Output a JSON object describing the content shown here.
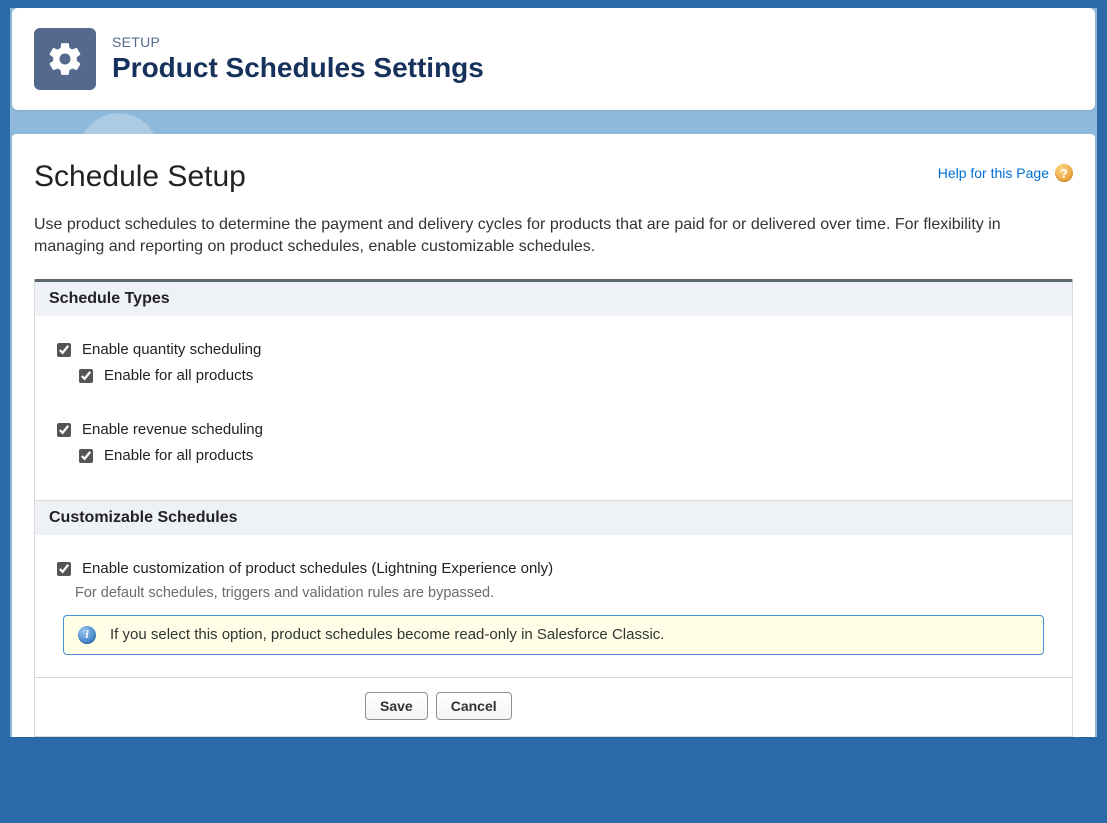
{
  "header": {
    "eyebrow": "SETUP",
    "title": "Product Schedules Settings"
  },
  "page": {
    "title": "Schedule Setup",
    "help_link_label": "Help for this Page",
    "help_icon_glyph": "?",
    "intro": "Use product schedules to determine the payment and delivery cycles for products that are paid for or delivered over time. For flexibility in managing and reporting on product schedules, enable customizable schedules."
  },
  "sections": {
    "schedule_types": {
      "heading": "Schedule Types",
      "quantity": {
        "label": "Enable quantity scheduling",
        "checked": true,
        "all_products": {
          "label": "Enable for all products",
          "checked": true
        }
      },
      "revenue": {
        "label": "Enable revenue scheduling",
        "checked": true,
        "all_products": {
          "label": "Enable for all products",
          "checked": true
        }
      }
    },
    "customizable": {
      "heading": "Customizable Schedules",
      "enable": {
        "label": "Enable customization of product schedules (Lightning Experience only)",
        "checked": true,
        "hint": "For default schedules, triggers and validation rules are bypassed."
      },
      "info": {
        "icon_glyph": "i",
        "text": "If you select this option, product schedules become read-only in Salesforce Classic."
      }
    }
  },
  "buttons": {
    "save": "Save",
    "cancel": "Cancel"
  }
}
